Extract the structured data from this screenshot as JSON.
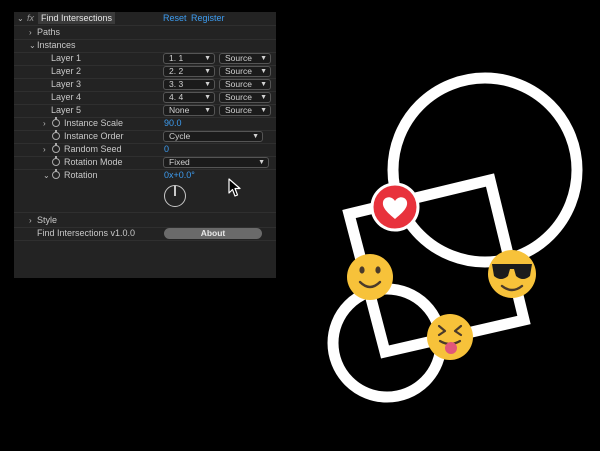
{
  "effect": {
    "fx_label": "fx",
    "title": "Find Intersections",
    "reset": "Reset",
    "register": "Register"
  },
  "sections": {
    "paths": "Paths",
    "instances": "Instances",
    "style": "Style"
  },
  "layers": [
    {
      "label": "Layer 1",
      "value": "1. 1",
      "source": "Source"
    },
    {
      "label": "Layer 2",
      "value": "2. 2",
      "source": "Source"
    },
    {
      "label": "Layer 3",
      "value": "3. 3",
      "source": "Source"
    },
    {
      "label": "Layer 4",
      "value": "4. 4",
      "source": "Source"
    },
    {
      "label": "Layer 5",
      "value": "None",
      "source": "Source"
    }
  ],
  "props": {
    "instance_scale": {
      "label": "Instance Scale",
      "value": "90.0"
    },
    "instance_order": {
      "label": "Instance Order",
      "value": "Cycle"
    },
    "random_seed": {
      "label": "Random Seed",
      "value": "0"
    },
    "rotation_mode": {
      "label": "Rotation Mode",
      "value": "Fixed"
    },
    "rotation": {
      "label": "Rotation",
      "value": "0x+0.0°"
    }
  },
  "footer": {
    "version": "Find Intersections v1.0.0",
    "about": "About"
  },
  "icons": {
    "twirl_open": "chevron-down-icon",
    "twirl_closed": "chevron-right-icon",
    "stopwatch": "stopwatch-icon",
    "heart": "heart-emoji",
    "smile": "smiley-emoji",
    "sunglasses": "sunglasses-emoji",
    "tongue": "tongue-emoji"
  },
  "colors": {
    "panel_bg": "#232323",
    "link_blue": "#3d9cf0",
    "heart_red": "#e8323c",
    "emoji_yellow": "#f7c23a"
  }
}
